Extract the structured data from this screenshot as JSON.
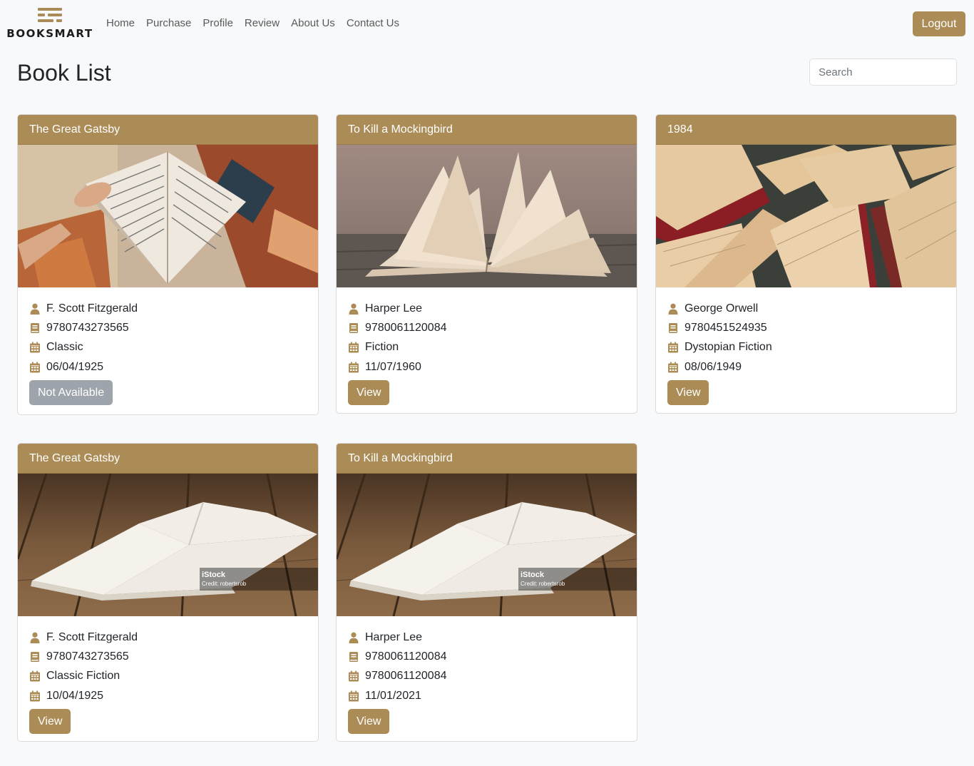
{
  "brand": {
    "name": "BOOKSMART"
  },
  "nav": {
    "links": [
      "Home",
      "Purchase",
      "Profile",
      "Review",
      "About Us",
      "Contact Us"
    ],
    "logout_label": "Logout"
  },
  "page": {
    "title": "Book List",
    "search_placeholder": "Search"
  },
  "colors": {
    "accent": "#ac8c56",
    "disabled": "#9ea4ab",
    "background": "#f8f9fa"
  },
  "books": [
    {
      "title": "The Great Gatsby",
      "author": "F. Scott Fitzgerald",
      "isbn": "9780743273565",
      "genre": "Classic",
      "date": "06/04/1925",
      "button": "Not Available"
    },
    {
      "title": "To Kill a Mockingbird",
      "author": "Harper Lee",
      "isbn": "9780061120084",
      "genre": "Fiction",
      "date": "11/07/1960",
      "button": "View"
    },
    {
      "title": "1984",
      "author": "George Orwell",
      "isbn": "9780451524935",
      "genre": "Dystopian Fiction",
      "date": "08/06/1949",
      "button": "View"
    },
    {
      "title": "The Great Gatsby",
      "author": "F. Scott Fitzgerald",
      "isbn": "9780743273565",
      "genre": "Classic Fiction",
      "date": "10/04/1925",
      "button": "View"
    },
    {
      "title": "To Kill a Mockingbird",
      "author": "Harper Lee",
      "isbn": "9780061120084",
      "genre": "9780061120084",
      "date": "11/01/2021",
      "button": "View"
    }
  ],
  "image_watermark": {
    "brand": "iStock",
    "credit": "Credit: robertsrob"
  }
}
